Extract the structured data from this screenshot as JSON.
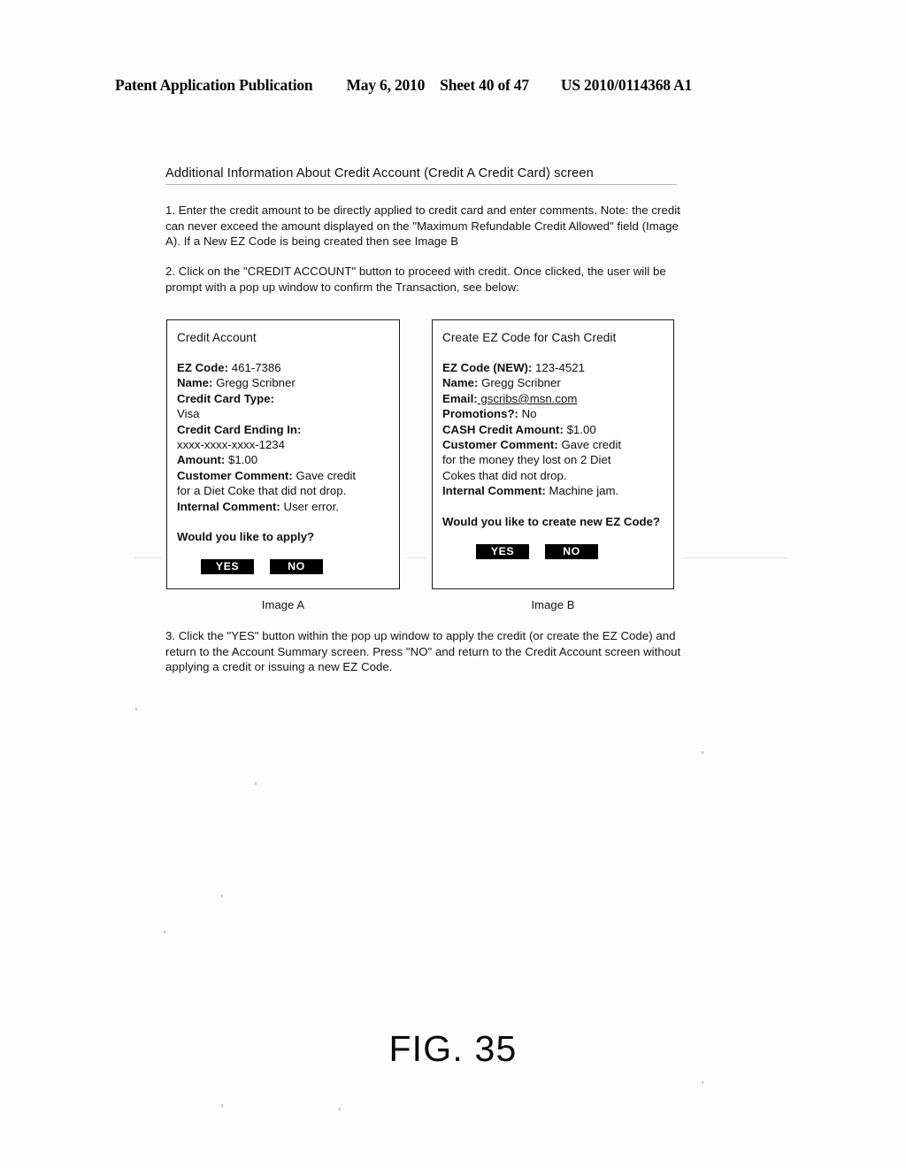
{
  "header": {
    "publication": "Patent Application Publication",
    "date": "May 6, 2010",
    "sheet": "Sheet 40 of 47",
    "patent_number": "US 2010/0114368 A1"
  },
  "screen_title": "Additional Information About Credit Account (Credit A Credit Card) screen",
  "instructions": {
    "step1": "1. Enter the credit amount to be directly applied to credit card and enter comments. Note: the credit can never exceed the amount displayed on the \"Maximum Refundable Credit Allowed\" field (Image A).  If a New EZ Code is being created then see Image B",
    "step2": "2. Click on the \"CREDIT ACCOUNT\" button to proceed with credit.  Once clicked, the user will be prompt with a pop up window to confirm the Transaction, see below:",
    "step3": "3.  Click the \"YES\" button within the pop up window to apply the credit (or create the EZ Code) and return to the Account Summary screen.  Press \"NO\" and return to the Credit Account screen without applying a credit or issuing a new EZ Code."
  },
  "image_a": {
    "caption": "Image A",
    "heading": "Credit Account",
    "fields": [
      {
        "label": "EZ Code:",
        "value": " 461-7386"
      },
      {
        "label": "Name:",
        "value": " Gregg Scribner"
      },
      {
        "label": "Credit Card Type:",
        "value": ""
      },
      {
        "label": "",
        "value": "Visa"
      },
      {
        "label": "Credit Card Ending In:",
        "value": ""
      },
      {
        "label": "",
        "value": "xxxx-xxxx-xxxx-1234"
      },
      {
        "label": "Amount:",
        "value": " $1.00"
      },
      {
        "label": "Customer Comment:",
        "value": " Gave credit"
      },
      {
        "label": "",
        "value": "for a Diet Coke that did not drop."
      },
      {
        "label": "Internal Comment:",
        "value": " User error."
      }
    ],
    "question": "Would you like to apply?",
    "buttons": [
      {
        "label": "YES"
      },
      {
        "label": "NO"
      }
    ]
  },
  "image_b": {
    "caption": "Image B",
    "heading": "Create EZ Code for Cash Credit",
    "fields": [
      {
        "label": "EZ Code (NEW):",
        "value": " 123-4521"
      },
      {
        "label": "Name:",
        "value": " Gregg Scribner"
      },
      {
        "label": "Email:",
        "value": " gscribs@msn.com",
        "link": true
      },
      {
        "label": "Promotions?:",
        "value": " No"
      },
      {
        "label": "CASH Credit Amount:",
        "value": " $1.00"
      },
      {
        "label": "Customer Comment:",
        "value": " Gave credit"
      },
      {
        "label": "",
        "value": "for the money they lost on 2 Diet"
      },
      {
        "label": "",
        "value": "Cokes that did not drop."
      },
      {
        "label": "Internal Comment:",
        "value": " Machine jam."
      }
    ],
    "question": "Would you like to create new EZ Code?",
    "buttons": [
      {
        "label": "YES"
      },
      {
        "label": "NO"
      }
    ]
  },
  "figure_label": "FIG. 35"
}
